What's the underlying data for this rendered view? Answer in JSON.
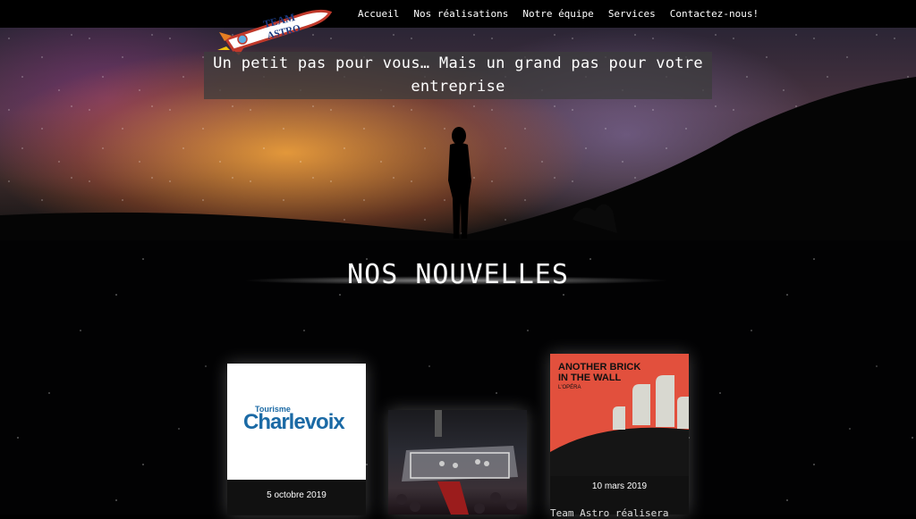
{
  "nav": {
    "items": [
      {
        "label": "Accueil"
      },
      {
        "label": "Nos réalisations"
      },
      {
        "label": "Notre équipe"
      },
      {
        "label": "Services"
      },
      {
        "label": "Contactez-nous!"
      }
    ]
  },
  "logo": {
    "line1": "TEAM",
    "line2": "ASTRO"
  },
  "hero": {
    "tagline": "Un petit pas pour vous… Mais un grand pas pour votre entreprise"
  },
  "news": {
    "title": "NOS NOUVELLES",
    "cards": [
      {
        "brand_small": "Tourisme",
        "brand_large": "Charlevoix",
        "date": "5 octobre 2019"
      },
      {
        "date": ""
      },
      {
        "poster_title": "ANOTHER BRICK IN THE WALL",
        "poster_sub": "L'OPÉRA",
        "date": "10 mars 2019",
        "caption": "Team Astro réalisera"
      }
    ]
  },
  "colors": {
    "accent_red": "#e2503d",
    "charlevoix_blue": "#1b6aa5"
  }
}
